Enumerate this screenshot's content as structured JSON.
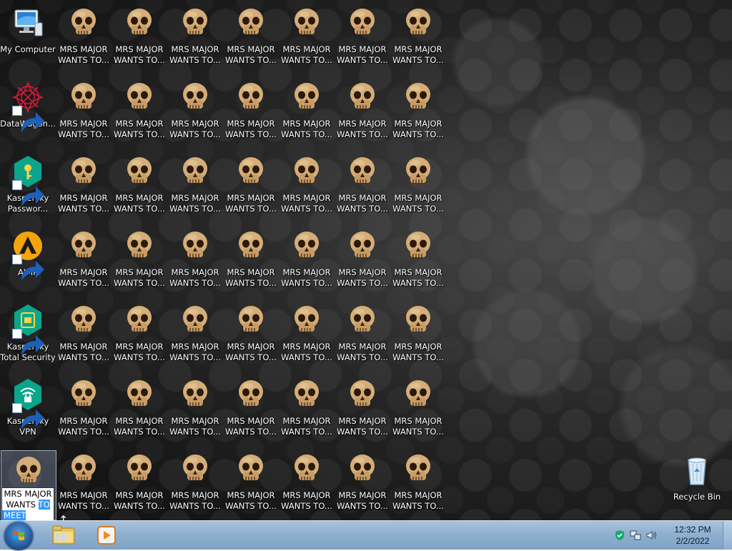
{
  "desktop": {
    "sidebar_icons": [
      {
        "label_line1": "My Computer",
        "label_line2": "",
        "icon": "computer-icon",
        "name": "desktop-icon-my-computer"
      },
      {
        "label_line1": "DataWagon...",
        "label_line2": "",
        "icon": "datawagon-icon",
        "name": "desktop-icon-datawagon"
      },
      {
        "label_line1": "Kaspersky",
        "label_line2": "Passwor...",
        "icon": "kaspersky-password-icon",
        "name": "desktop-icon-kaspersky-password"
      },
      {
        "label_line1": "AIMP",
        "label_line2": "",
        "icon": "aimp-icon",
        "name": "desktop-icon-aimp"
      },
      {
        "label_line1": "Kaspersky",
        "label_line2": "Total Security",
        "icon": "kaspersky-total-security-icon",
        "name": "desktop-icon-kaspersky-total-security"
      },
      {
        "label_line1": "Kaspersky",
        "label_line2": "VPN",
        "icon": "kaspersky-vpn-icon",
        "name": "desktop-icon-kaspersky-vpn"
      }
    ],
    "skull_label_line1": "MRS MAJOR",
    "skull_label_line2": "WANTS TO...",
    "skull_icon": "skull-icon",
    "rename": {
      "line1": "MRS MAJOR",
      "line2_plain": "WANTS ",
      "line2_selected": "TO",
      "line3_selected": "MEET YOU"
    },
    "recycle_bin": {
      "label": "Recycle Bin",
      "icon": "recycle-bin-icon"
    }
  },
  "taskbar": {
    "start_icon": "windows-start-icon",
    "pinned": [
      {
        "name": "explorer-button",
        "icon": "folder-icon"
      },
      {
        "name": "media-player-button",
        "icon": "media-player-icon"
      }
    ],
    "tray": {
      "icons": [
        "security-shield-icon",
        "network-icon",
        "volume-icon"
      ],
      "time": "12:32 PM",
      "date": "2/2/2022"
    }
  },
  "colors": {
    "taskbar": "#8fb0cf",
    "selection": "#3399ff",
    "skull": "#c9a06a"
  }
}
